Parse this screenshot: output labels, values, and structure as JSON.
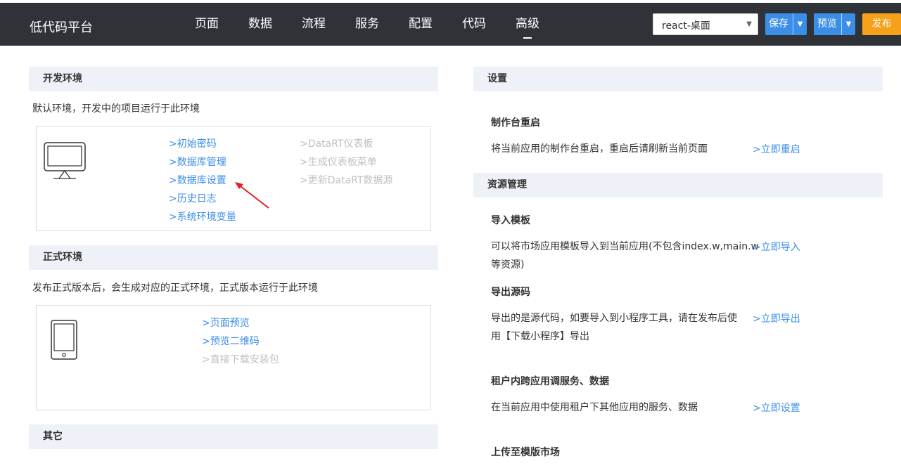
{
  "header": {
    "brand": "低代码平台",
    "nav": [
      "页面",
      "数据",
      "流程",
      "服务",
      "配置",
      "代码",
      "高级"
    ],
    "env_select": "react-桌面",
    "save": "保存",
    "preview": "预览",
    "publish": "发布"
  },
  "left": {
    "dev": {
      "title": "开发环境",
      "desc": "默认环境，开发中的项目运行于此环境",
      "links": [
        ">初始密码",
        ">数据库管理",
        ">数据库设置",
        ">历史日志",
        ">系统环境变量"
      ],
      "disabled_links": [
        ">DataRT仪表板",
        ">生成仪表板菜单",
        ">更新DataRT数据源"
      ]
    },
    "prod": {
      "title": "正式环境",
      "desc": "发布正式版本后，会生成对应的正式环境，正式版本运行于此环境",
      "links": [
        ">页面预览",
        ">预览二维码"
      ],
      "disabled_links": [
        ">直接下载安装包"
      ]
    },
    "other": {
      "title": "其它"
    }
  },
  "right": {
    "settings": {
      "title": "设置",
      "restart_title": "制作台重启",
      "restart_desc": "将当前应用的制作台重启，重启后请刷新当前页面",
      "restart_link": ">立即重启"
    },
    "resources": {
      "title": "资源管理",
      "import_title": "导入模板",
      "import_desc_1": "可以将市场应用模板导入到当前应用(不包含index.w,main.w",
      "import_desc_2": "等资源)",
      "import_link": ">立即导入",
      "export_title": "导出源码",
      "export_desc_1": "导出的是源代码，如要导入到小程序工具，请在发布后使",
      "export_desc_2": "用【下载小程序】导出",
      "export_link": ">立即导出",
      "tenant_title": "租户内跨应用调服务、数据",
      "tenant_desc": "在当前应用中使用租户下其他应用的服务、数据",
      "tenant_link": ">立即设置",
      "upload_title": "上传至模版市场"
    }
  }
}
